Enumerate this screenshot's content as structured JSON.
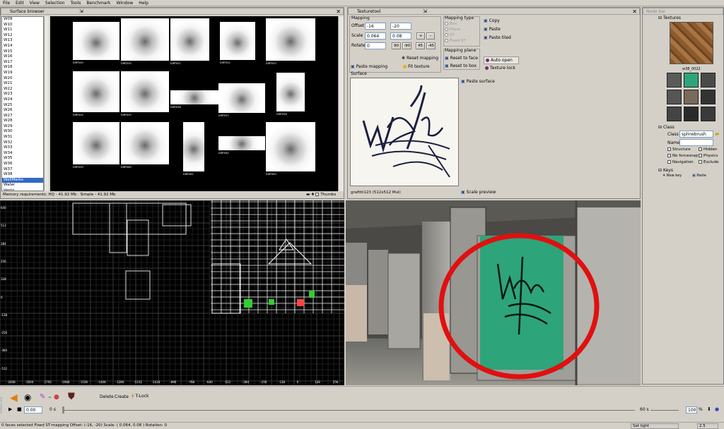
{
  "menu": [
    "File",
    "Edit",
    "View",
    "Selection",
    "Tools",
    "Benchmark",
    "Window",
    "Help"
  ],
  "surface_browser": {
    "title": "Surface browser",
    "folders": [
      "W09",
      "W10",
      "W11",
      "W12",
      "W13",
      "W14",
      "W15",
      "W16",
      "W17",
      "W18",
      "W19",
      "W20",
      "W21",
      "W22",
      "W23",
      "W24",
      "W25",
      "W26",
      "W27",
      "W28",
      "W29",
      "W30",
      "W31",
      "W32",
      "W33",
      "W34",
      "W35",
      "W36",
      "W37",
      "W38",
      "WallMarks",
      "Water",
      "Vents",
      "Videos",
      "Windows"
    ],
    "selected_folder": "WallMarks",
    "textures": [
      {
        "name": "DIRT049"
      },
      {
        "name": "DIRT050"
      },
      {
        "name": "DIRT051"
      },
      {
        "name": "DIRT052"
      },
      {
        "name": "DIRT053"
      },
      {
        "name": "DIRT054"
      },
      {
        "name": "DIRT055"
      },
      {
        "name": "DIRT056"
      },
      {
        "name": "DIRT057"
      },
      {
        "name": "DIRT058"
      },
      {
        "name": "DIRT059"
      },
      {
        "name": "DIRT060"
      },
      {
        "name": "DIRT061"
      },
      {
        "name": "DIRT062"
      },
      {
        "name": "DIRT063"
      }
    ],
    "memory": "Memory requirements: HQ - 41.92 Mb · Simple - 41.92 Mb",
    "thumbs_label": "Thumbs"
  },
  "texturetool": {
    "title": "Texturetool",
    "mapping_label": "Mapping",
    "offset_label": "Offset",
    "offset_x": "-16",
    "offset_y": "-20",
    "scale_label": "Scale",
    "scale_x": "0.064",
    "scale_y": "0.08",
    "rotate_label": "Rotate",
    "rotate_value": "0",
    "btn_plus": "+",
    "btn_minus": "-",
    "btn_90": "90",
    "btn_m90": "-90",
    "btn_45": "45",
    "btn_m45": "-45",
    "reset_mapping": "Reset mapping",
    "paste_mapping": "Paste mapping",
    "fit_texture": "Fit texture",
    "mapping_type_label": "Mapping type",
    "mapping_types": [
      "Box",
      "Plane",
      "ST",
      "Fixed ST"
    ],
    "mapping_plane_label": "Mapping plane",
    "reset_to_face": "Reset to face",
    "reset_to_box": "Reset to box",
    "copy": "Copy",
    "paste": "Paste",
    "paste_tiled": "Paste tiled",
    "auto_open": "Auto open",
    "texture_lock": "Texture lock",
    "surface_label": "Surface",
    "paste_surface": "Paste surface",
    "surface_name": "grafitti123 (512x512 Mul)",
    "scale_preview": "Scale preview",
    "graffiti_text": "WEAR"
  },
  "node_bar": {
    "title": "Node bar",
    "textures_label": "Textures",
    "texture_name": "w38_0022",
    "class_section": "Class",
    "class_label": "Class",
    "class_value": "splinebrush",
    "name_label": "Name",
    "name_value": "",
    "flags": [
      "Structure",
      "Hidden",
      "No forcesnap",
      "Physics",
      "Navigation",
      "Exclude"
    ],
    "keys_section": "Keys",
    "new_key": "New key",
    "paste_key": "Paste"
  },
  "viewport_2d": {
    "y_labels": [
      "640",
      "512",
      "384",
      "256",
      "128",
      "0",
      "-128",
      "-256",
      "-384",
      "-512"
    ],
    "x_labels": [
      "-2048",
      "-1920",
      "-1792",
      "-1664",
      "-1536",
      "-1408",
      "-1280",
      "-1152",
      "-1024",
      "-896",
      "-768",
      "-640",
      "-512",
      "-384",
      "-256",
      "-128",
      "0",
      "128",
      "256"
    ]
  },
  "timeline": {
    "button_bar_label": "Button bar",
    "delete_label": "Delete",
    "create_label": "Create",
    "tlock_label": "T-Lock",
    "time_value": "0.00",
    "time_start": "0 s",
    "time_end": "60 s",
    "zoom_value": "100",
    "zoom_unit": "%"
  },
  "status": {
    "main": "0 faces selected  Fixed ST-mapping  Offset: (-16, -20)  Scale: ( 0.064, 0.08 )  Rotation: 0",
    "light": "Set light",
    "value": "2.5"
  },
  "colors": {
    "selection": "#316ac5",
    "annotation_circle": "#e01010",
    "graffiti_panel": "#2ea47a",
    "panel_bg": "#d4d0c8"
  }
}
